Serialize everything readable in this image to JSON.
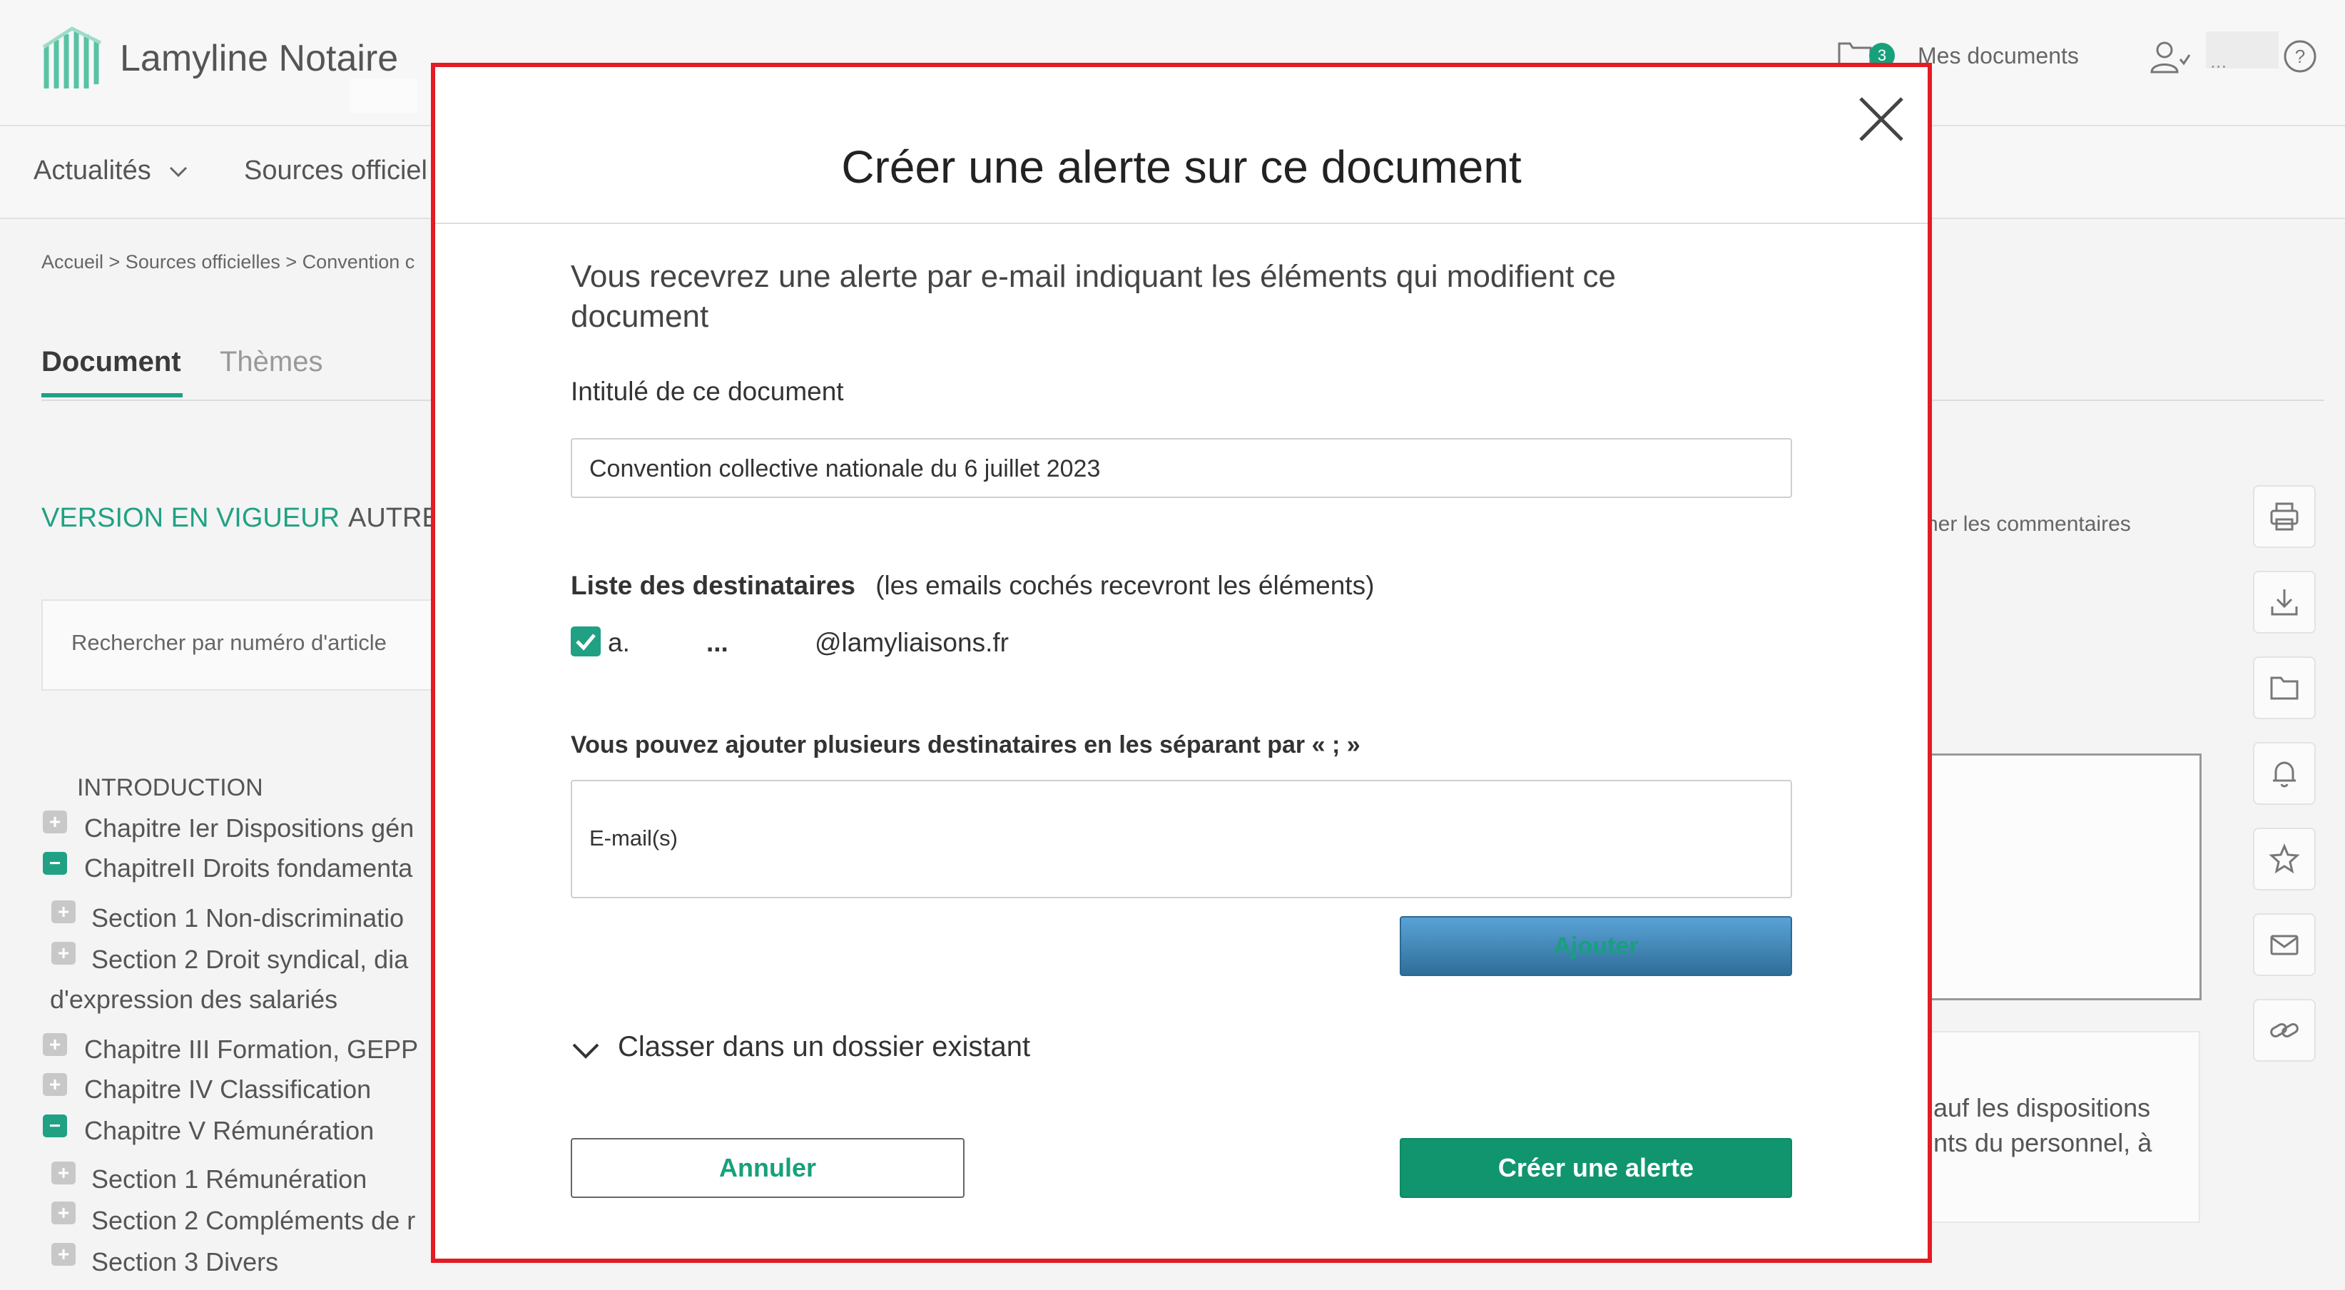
{
  "header": {
    "app_name": "Lamyline Notaire",
    "docs_badge": "3",
    "docs_label": "Mes documents",
    "user_name": "...",
    "icons": [
      "logo-icon",
      "folder-icon",
      "user-icon",
      "help-icon"
    ]
  },
  "nav": {
    "items": [
      {
        "label": "Actualités"
      },
      {
        "label": "Sources officiel"
      }
    ]
  },
  "breadcrumb": "Accueil > Sources officielles > Convention c",
  "tabs": [
    {
      "label": "Document"
    },
    {
      "label": "Thèmes"
    }
  ],
  "version": {
    "current_label": "VERSION EN VIGUEUR",
    "other_label": "AUTRE"
  },
  "search": {
    "placeholder": "Rechercher par numéro d'article"
  },
  "toc": {
    "intro": "INTRODUCTION",
    "items": [
      {
        "label": "Chapitre Ier Dispositions gén",
        "toggle": "+"
      },
      {
        "label": "ChapitreII Droits fondamenta",
        "toggle": "−"
      },
      {
        "label": "Section 1 Non-discriminatio",
        "toggle": "+"
      },
      {
        "label": "Section 2 Droit syndical, dia",
        "toggle": "+"
      },
      {
        "label": "d'expression des salariés",
        "toggle": ""
      },
      {
        "label": "Chapitre III Formation, GEPP",
        "toggle": "+"
      },
      {
        "label": "Chapitre IV Classification",
        "toggle": "+"
      },
      {
        "label": "Chapitre V Rémunération",
        "toggle": "−"
      },
      {
        "label": "Section 1 Rémunération",
        "toggle": "+"
      },
      {
        "label": "Section 2 Compléments de r",
        "toggle": "+"
      },
      {
        "label": "Section 3 Divers",
        "toggle": "+"
      }
    ]
  },
  "right": {
    "comments_label": "her les commentaires",
    "text_line1": "auf les dispositions",
    "text_line2": "nts du personnel, à",
    "side_icons": [
      "print-icon",
      "download-icon",
      "folder-icon",
      "bell-icon",
      "star-icon",
      "mail-icon",
      "link-icon"
    ]
  },
  "modal": {
    "title": "Créer une alerte sur ce document",
    "intro": "Vous recevrez une alerte par e-mail indiquant les éléments qui modifient ce document",
    "doc_title_label": "Intitulé de ce document",
    "doc_title_value": "Convention collective nationale du 6 juillet 2023",
    "recipients_label": "Liste des destinataires",
    "recipients_note": "(les emails cochés recevront les éléments)",
    "recipient": {
      "checked": true,
      "prefix": "a.",
      "middle": "...",
      "domain": "@lamyliaisons.fr"
    },
    "hint": "Vous pouvez ajouter plusieurs destinataires en les séparant par « ; »",
    "email_placeholder": "E-mail(s)",
    "add_button": "Ajouter",
    "folder_toggle": "Classer dans un dossier existant",
    "cancel_button": "Annuler",
    "create_button": "Créer une alerte"
  }
}
